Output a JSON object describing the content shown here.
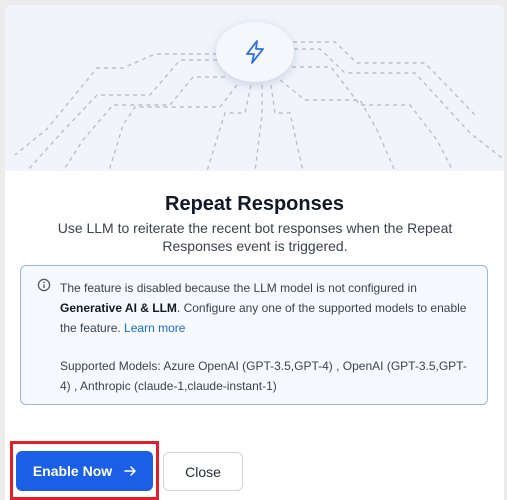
{
  "dialog": {
    "hero_icon": "lightning-bolt-icon",
    "title": "Repeat Responses",
    "subtitle": "Use LLM to reiterate the recent bot responses when the Repeat Responses event is triggered."
  },
  "info": {
    "icon": "info-circle-icon",
    "text_part1": "The feature is disabled because the LLM model is not configured in ",
    "text_bold": "Generative AI & LLM",
    "text_part2": ". Configure any one of the supported models to enable the feature. ",
    "learn_more": "Learn more",
    "supported_models": "Supported Models: Azure OpenAI (GPT-3.5,GPT-4) , OpenAI (GPT-3.5,GPT-4) , Anthropic (claude-1,claude-instant-1)"
  },
  "actions": {
    "enable_label": "Enable Now",
    "enable_icon": "arrow-right-icon",
    "close_label": "Close"
  },
  "colors": {
    "primary": "#1b5fe6",
    "link": "#1a6bdb",
    "highlight": "#e21f26",
    "info_border": "#9bb6e6"
  }
}
